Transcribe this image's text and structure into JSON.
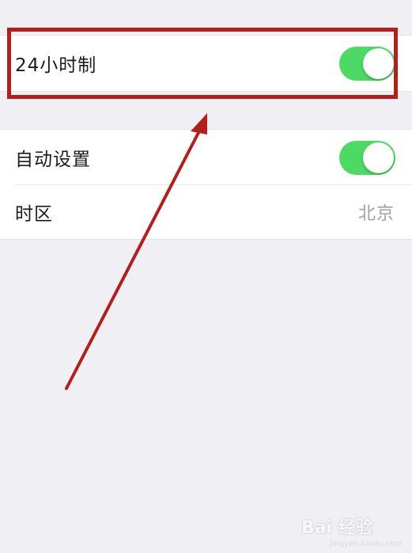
{
  "settings": {
    "group1": {
      "rows": [
        {
          "label": "24小时制",
          "toggle_on": true
        }
      ]
    },
    "group2": {
      "rows": [
        {
          "label": "自动设置",
          "toggle_on": true
        },
        {
          "label": "时区",
          "value": "北京"
        }
      ]
    }
  },
  "annotation": {
    "box_color": "#b3201c",
    "arrow_color": "#b3201c"
  },
  "colors": {
    "background": "#efeff4",
    "toggle_on": "#4cd964",
    "secondary_text": "#a0a0a5"
  },
  "watermark": {
    "text": "Bai 经验",
    "subtext": "jingyan.baidu.com"
  }
}
